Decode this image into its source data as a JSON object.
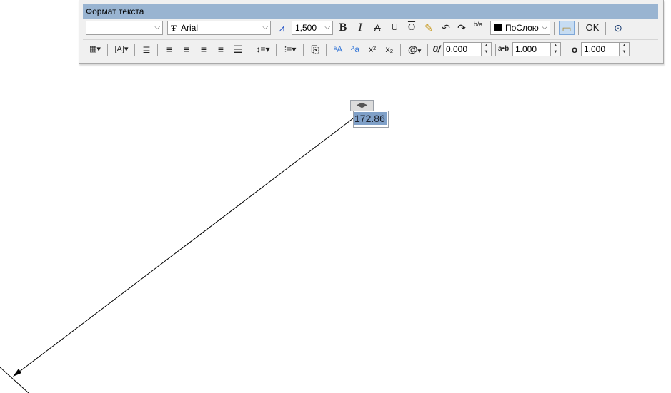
{
  "toolbar": {
    "title": "Формат текста",
    "style_combo": {
      "value": ""
    },
    "font_combo": {
      "value": "Arial"
    },
    "height_combo": {
      "value": "1,500"
    },
    "bold": "B",
    "italic": "I",
    "strike": "A",
    "underline": "U",
    "overline": "O",
    "stack": "b/a",
    "color_combo": {
      "value": "ПоСлою"
    },
    "ok_label": "OK",
    "oblique_value": "0.000",
    "tracking_value": "1.000",
    "width_value": "1.000",
    "oblique_glyph": "0/",
    "tracking_glyph": "a•b",
    "width_glyph": "o",
    "superscript_glyph": "x²",
    "subscript_glyph": "x₂",
    "symbol_glyph": "@",
    "uppercase_glyph": "ᵃA",
    "lowercase_glyph": "ᴬa"
  },
  "editor": {
    "text": "172.86",
    "handle_glyph": "◀▶"
  },
  "colors": {
    "title_bar": "#99b4d1",
    "toolbar_bg": "#f0f0f0",
    "selection": "#7fa0c8"
  }
}
